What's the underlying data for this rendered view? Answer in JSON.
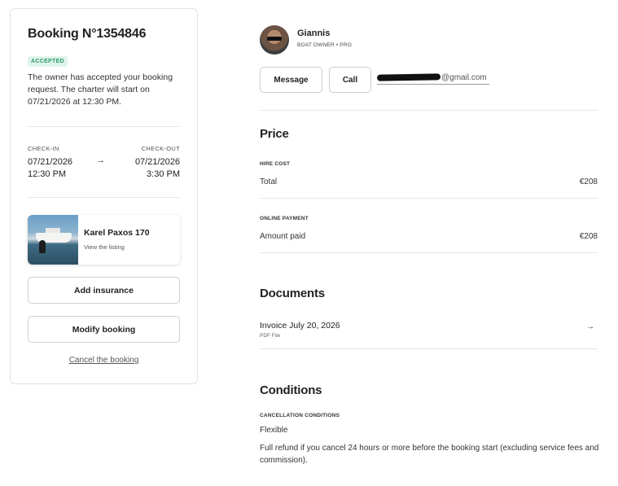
{
  "booking": {
    "title": "Booking N°1354846",
    "status_badge": "ACCEPTED",
    "status_text": "The owner has accepted your booking request. The charter will start on 07/21/2026 at 12:30 PM.",
    "checkin_label": "CHECK-IN",
    "checkout_label": "CHECK-OUT",
    "checkin_date": "07/21/2026",
    "checkin_time": "12:30 PM",
    "checkout_date": "07/21/2026",
    "checkout_time": "3:30 PM",
    "arrow": "→"
  },
  "listing": {
    "name": "Karel Paxos 170",
    "link": "View the listing"
  },
  "actions": {
    "add_insurance": "Add insurance",
    "modify_booking": "Modify booking",
    "cancel_booking": "Cancel the booking"
  },
  "owner": {
    "name": "Giannis",
    "role": "BOAT OWNER • PRO",
    "message_label": "Message",
    "call_label": "Call",
    "email_suffix": "@gmail.com"
  },
  "price": {
    "heading": "Price",
    "hire_caption": "HIRE COST",
    "total_label": "Total",
    "total_value": "€208",
    "online_caption": "ONLINE PAYMENT",
    "paid_label": "Amount paid",
    "paid_value": "€208"
  },
  "documents": {
    "heading": "Documents",
    "invoice_title": "Invoice July 20, 2026",
    "invoice_type": "PDF File",
    "arrow": "→"
  },
  "conditions": {
    "heading": "Conditions",
    "caption": "CANCELLATION CONDITIONS",
    "policy": "Flexible",
    "details": "Full refund if you cancel 24 hours or more before the booking start (excluding service fees and commission)."
  },
  "colors": {
    "badge_bg": "#dff4ec",
    "badge_text": "#2e9a6e"
  }
}
